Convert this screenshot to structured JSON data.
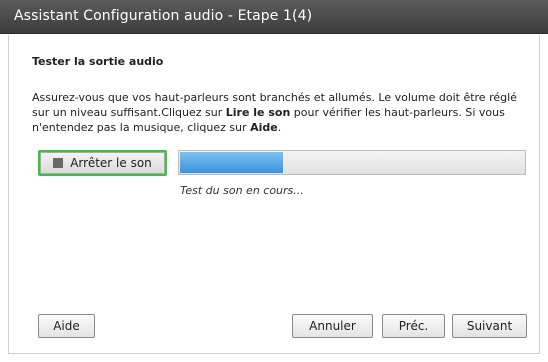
{
  "window": {
    "title": "Assistant Configuration audio - Etape 1(4)"
  },
  "section": {
    "title": "Tester la sortie audio"
  },
  "instructions": {
    "part1": "Assurez-vous que vos haut-parleurs sont branchés et allumés. Le volume doit être réglé sur un niveau suffisant.Cliquez sur ",
    "bold1": "Lire le son",
    "part2": " pour vérifier les haut-parleurs. Si vous n'entendez pas la musique, cliquez sur ",
    "bold2": "Aide",
    "part3": "."
  },
  "audio_test": {
    "stop_label": "Arrêter le son",
    "progress_fraction": 0.3,
    "status": "Test du son en cours..."
  },
  "footer": {
    "help_label": "Aide",
    "cancel_label": "Annuler",
    "prev_label": "Préc.",
    "next_label": "Suivant"
  },
  "colors": {
    "focus_ring": "#39c23d",
    "progress_fill": "#3b93df",
    "titlebar": "#4a4a4a"
  },
  "icons": {
    "stop": "stop-icon"
  }
}
